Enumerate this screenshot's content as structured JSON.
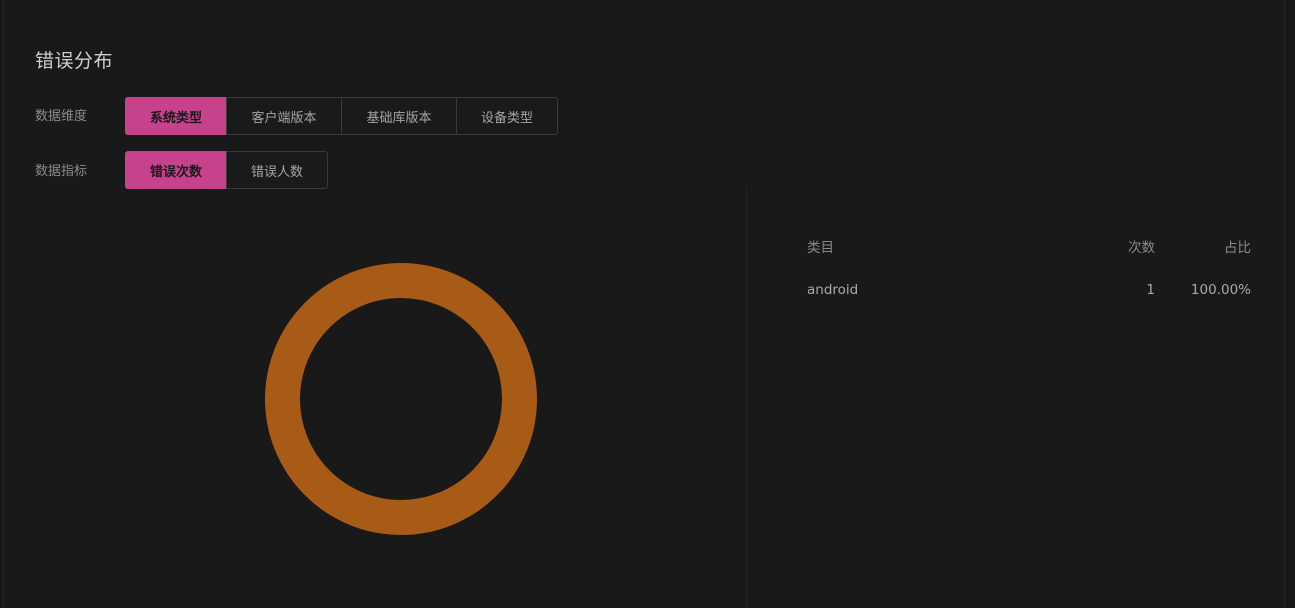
{
  "section": {
    "title": "错误分布"
  },
  "dimension": {
    "label": "数据维度",
    "options": [
      "系统类型",
      "客户端版本",
      "基础库版本",
      "设备类型"
    ],
    "selected": "系统类型"
  },
  "metric": {
    "label": "数据指标",
    "options": [
      "错误次数",
      "错误人数"
    ],
    "selected": "错误次数"
  },
  "colors": {
    "accent": "#c7428c",
    "donut": "#a85b17",
    "background": "#191919"
  },
  "chart_data": {
    "type": "pie",
    "donut": true,
    "categories": [
      "android"
    ],
    "values": [
      1
    ],
    "colors": [
      "#a85b17"
    ]
  },
  "table": {
    "headers": {
      "category": "类目",
      "count": "次数",
      "percent": "占比"
    },
    "rows": [
      {
        "category": "android",
        "count": "1",
        "percent": "100.00%"
      }
    ]
  }
}
